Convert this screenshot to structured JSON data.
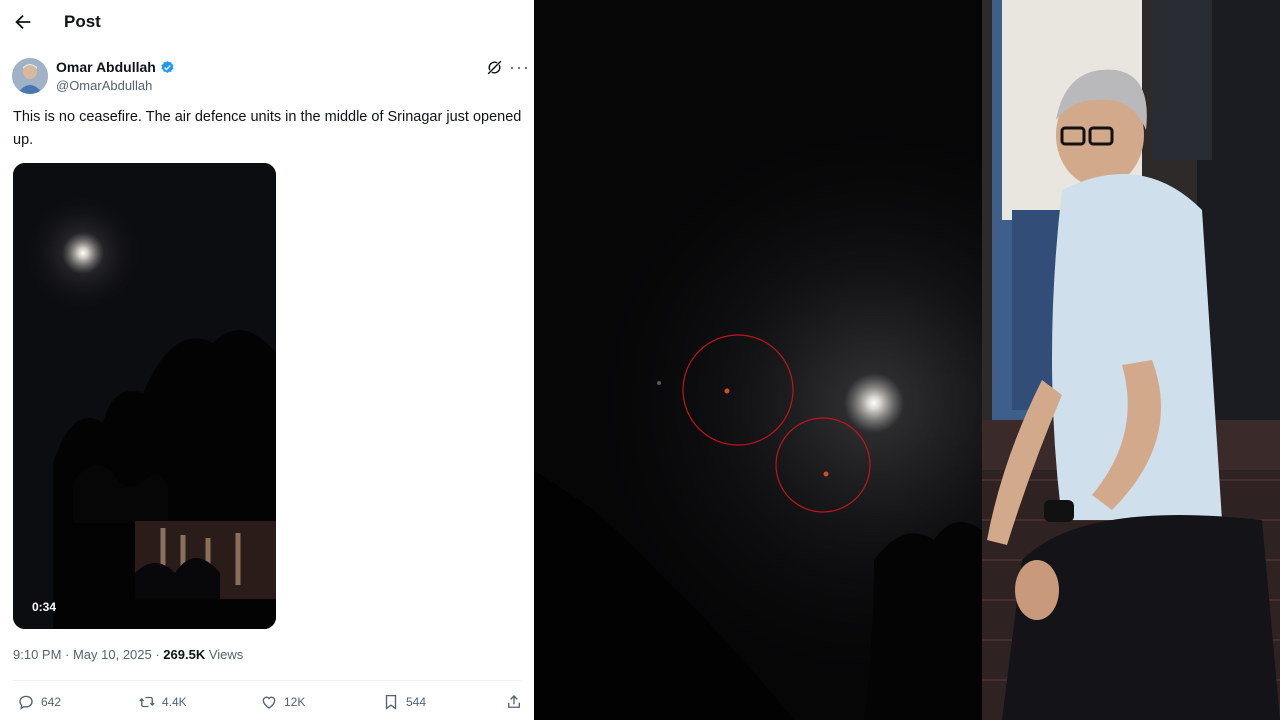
{
  "header": {
    "title": "Post"
  },
  "post": {
    "author_name": "Omar Abdullah",
    "author_handle": "@OmarAbdullah",
    "text": "This is no ceasefire. The air defence units in the middle of Srinagar just opened up.",
    "video_duration": "0:34",
    "time": "9:10 PM · May 10, 2025 · ",
    "views_count": "269.5K",
    "views_label": " Views"
  },
  "actions": {
    "replies": "642",
    "reposts": "4.4K",
    "likes": "12K",
    "bookmarks": "544"
  },
  "colors": {
    "verified": "#1d9bf0",
    "circle_annotation": "#c0141e",
    "text_primary": "#0f1419",
    "text_secondary": "#536471"
  }
}
